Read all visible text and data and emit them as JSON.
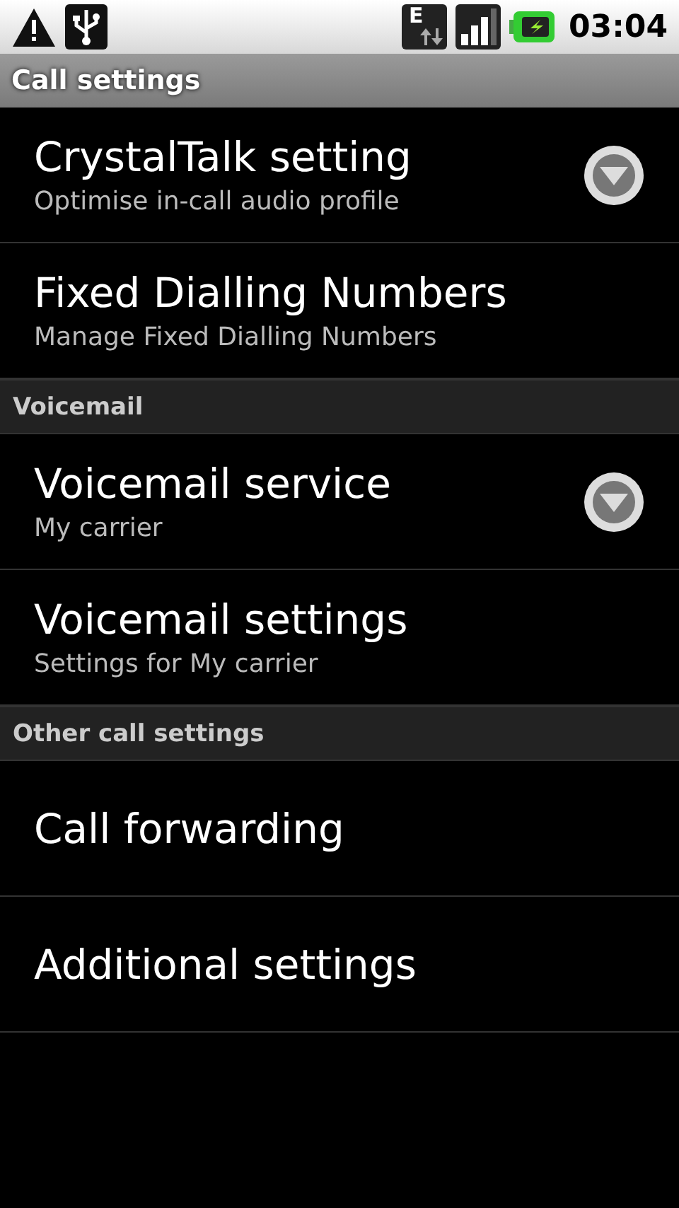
{
  "status_bar": {
    "network_type": "E",
    "time": "03:04"
  },
  "title": "Call settings",
  "sections": [
    {
      "items": [
        {
          "title": "CrystalTalk setting",
          "summary": "Optimise in-call audio profile",
          "kind": "dropdown"
        },
        {
          "title": "Fixed Dialling Numbers",
          "summary": "Manage Fixed Dialling Numbers",
          "kind": "link"
        }
      ]
    },
    {
      "header": "Voicemail",
      "items": [
        {
          "title": "Voicemail service",
          "summary": "My carrier",
          "kind": "dropdown"
        },
        {
          "title": "Voicemail settings",
          "summary": "Settings for My carrier",
          "kind": "link"
        }
      ]
    },
    {
      "header": "Other call settings",
      "items": [
        {
          "title": "Call forwarding",
          "kind": "link"
        },
        {
          "title": "Additional settings",
          "kind": "link"
        }
      ]
    }
  ]
}
